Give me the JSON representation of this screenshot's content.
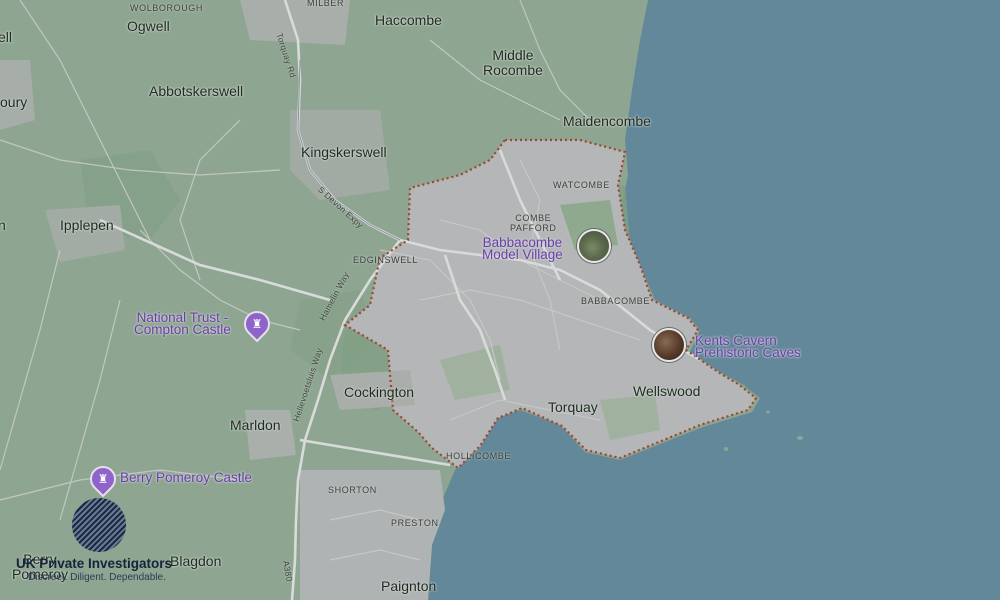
{
  "map": {
    "places": [
      {
        "id": "wolborough",
        "text": "WOLBOROUGH"
      },
      {
        "id": "milber",
        "text": "MILBER"
      },
      {
        "id": "ogwell",
        "text": "Ogwell"
      },
      {
        "id": "haccombe",
        "text": "Haccombe"
      },
      {
        "id": "ell",
        "text": "ell"
      },
      {
        "id": "middle-rocombe",
        "text": "Middle\nRocombe"
      },
      {
        "id": "abbotskerswell",
        "text": "Abbotskerswell"
      },
      {
        "id": "oury",
        "text": "oury"
      },
      {
        "id": "maidencombe",
        "text": "Maidencombe"
      },
      {
        "id": "kingskerswell",
        "text": "Kingskerswell"
      },
      {
        "id": "watcombe",
        "text": "WATCOMBE"
      },
      {
        "id": "ipplepen",
        "text": "Ipplepen"
      },
      {
        "id": "n",
        "text": "n"
      },
      {
        "id": "combe-pafford",
        "text": "COMBE\nPAFFORD"
      },
      {
        "id": "edginswell",
        "text": "EDGINSWELL"
      },
      {
        "id": "babbacombe",
        "text": "BABBACOMBE"
      },
      {
        "id": "cockington",
        "text": "Cockington"
      },
      {
        "id": "torquay",
        "text": "Torquay"
      },
      {
        "id": "wellswood",
        "text": "Wellswood"
      },
      {
        "id": "marldon",
        "text": "Marldon"
      },
      {
        "id": "hollicombe",
        "text": "HOLLICOMBE"
      },
      {
        "id": "shorton",
        "text": "SHORTON"
      },
      {
        "id": "preston",
        "text": "PRESTON"
      },
      {
        "id": "berry-pomeroy",
        "text": "Berry\nPomeroy"
      },
      {
        "id": "blagdon",
        "text": "Blagdon"
      },
      {
        "id": "paignton",
        "text": "Paignton"
      }
    ],
    "roads": [
      {
        "id": "torquay-rd",
        "text": "Torquay Rd"
      },
      {
        "id": "s-devon-expy",
        "text": "S Devon Expy"
      },
      {
        "id": "hamelin-way",
        "text": "Hamelin Way"
      },
      {
        "id": "hellevoetsluis-way",
        "text": "Hellevoetsluis Way"
      },
      {
        "id": "a380",
        "text": "A380"
      }
    ],
    "pois": [
      {
        "id": "babbacombe-model-village",
        "text": "Babbacombe\nModel Village",
        "icon": "photo-thumbnail"
      },
      {
        "id": "kents-cavern",
        "text": "Kents Cavern\nPrehistoric Caves",
        "icon": "photo-thumbnail"
      },
      {
        "id": "compton-castle",
        "text": "National Trust -\nCompton Castle",
        "icon": "castle-icon"
      },
      {
        "id": "berry-pomeroy-castle",
        "text": "Berry Pomeroy Castle",
        "icon": "castle-icon"
      }
    ],
    "colors": {
      "land": "#8ea691",
      "urban": "#b4b6b7",
      "sea": "#63889a",
      "boundary": "#a0442e",
      "poi": "#6a3ea3"
    }
  },
  "logo": {
    "name": "UK Private Investigators",
    "tagline": "Discreet. Diligent. Dependable."
  }
}
